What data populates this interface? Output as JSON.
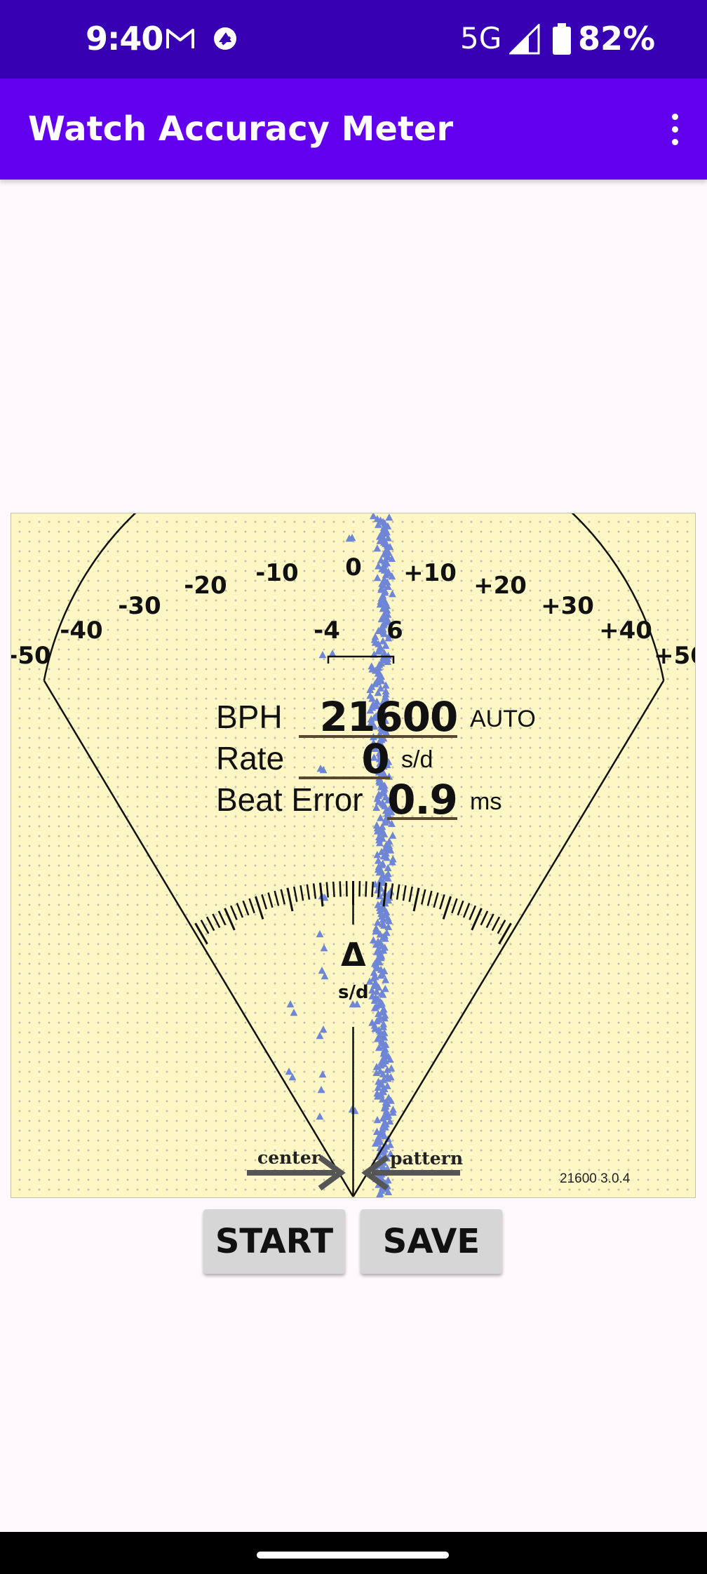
{
  "status_bar": {
    "time": "9:40",
    "network": "5G",
    "battery": "82%",
    "icons": [
      "gmail-icon",
      "notification-app-icon",
      "cellular-signal-icon",
      "battery-icon"
    ]
  },
  "app_bar": {
    "title": "Watch Accuracy Meter",
    "menu_icon": "overflow-menu-icon"
  },
  "meter": {
    "scale_labels": [
      "-50",
      "-40",
      "-30",
      "-20",
      "-10",
      "0",
      "+10",
      "+20",
      "+30",
      "+40",
      "+50"
    ],
    "tolerance_labels": [
      "-4",
      "6"
    ],
    "bph_label": "BPH",
    "bph_value": "21600",
    "bph_mode": "AUTO",
    "rate_label": "Rate",
    "rate_value": "0",
    "rate_unit": "s/d",
    "beat_error_label": "Beat Error",
    "beat_error_value": "0.9",
    "beat_error_unit": "ms",
    "delta_symbol": "Δ",
    "delta_unit": "s/d",
    "center_label": "center",
    "pattern_label": "pattern",
    "version": "21600 3.0.4",
    "colors": {
      "background": "#fdf7c6",
      "trace": "#6f86d6"
    }
  },
  "buttons": {
    "start": "START",
    "save": "SAVE"
  }
}
